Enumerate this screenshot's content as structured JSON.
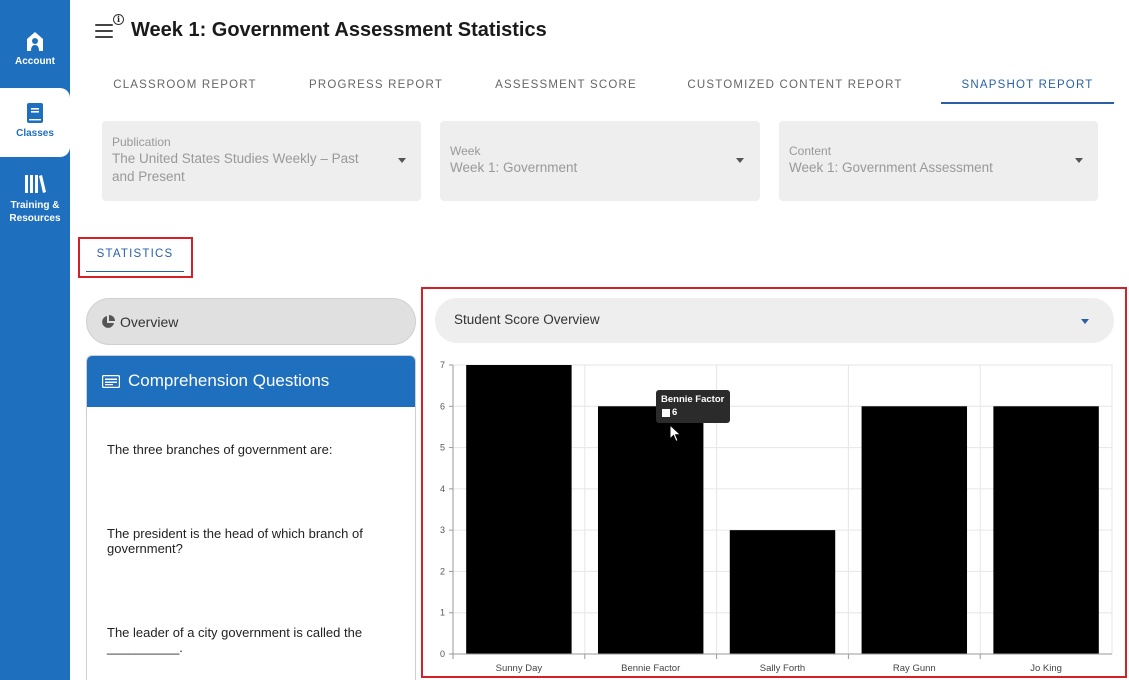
{
  "sidebar": {
    "items": [
      {
        "label": "Account",
        "icon": "account-icon"
      },
      {
        "label": "Classes",
        "icon": "book-icon"
      },
      {
        "label_line1": "Training &",
        "label_line2": "Resources",
        "icon": "library-icon"
      }
    ]
  },
  "header": {
    "title": "Week 1: Government Assessment Statistics"
  },
  "tabs": [
    {
      "label": "CLASSROOM REPORT"
    },
    {
      "label": "PROGRESS REPORT"
    },
    {
      "label": "ASSESSMENT SCORE"
    },
    {
      "label": "CUSTOMIZED CONTENT REPORT"
    },
    {
      "label": "SNAPSHOT REPORT",
      "active": true
    }
  ],
  "filters": {
    "publication": {
      "label": "Publication",
      "value_line1": "The United States Studies Weekly – Past",
      "value_line2": "and Present"
    },
    "week": {
      "label": "Week",
      "value": "Week 1: Government"
    },
    "content": {
      "label": "Content",
      "value": "Week 1: Government Assessment"
    }
  },
  "statistics_tab": {
    "label": "STATISTICS"
  },
  "overview": {
    "label": "Overview"
  },
  "comprehension": {
    "title": "Comprehension Questions",
    "questions": [
      "The three branches of government are:",
      "The president is the head of which branch of government?",
      "The leader of a city government is called the __________."
    ]
  },
  "chart_select": {
    "label": "Student Score Overview"
  },
  "tooltip": {
    "name": "Bennie Factor",
    "value": "6"
  },
  "chart_data": {
    "type": "bar",
    "categories": [
      "Sunny Day",
      "Bennie Factor",
      "Sally Forth",
      "Ray Gunn",
      "Jo King"
    ],
    "values": [
      7,
      6,
      3,
      6,
      6
    ],
    "yticks": [
      "0",
      "1",
      "2",
      "3",
      "4",
      "5",
      "6",
      "7"
    ],
    "ylim": [
      0,
      7
    ],
    "bar_color": "#000000",
    "grid": true
  },
  "colors": {
    "sidebar": "#1f6fbf",
    "accent": "#2a5fa8",
    "highlight_border": "#d32029"
  }
}
